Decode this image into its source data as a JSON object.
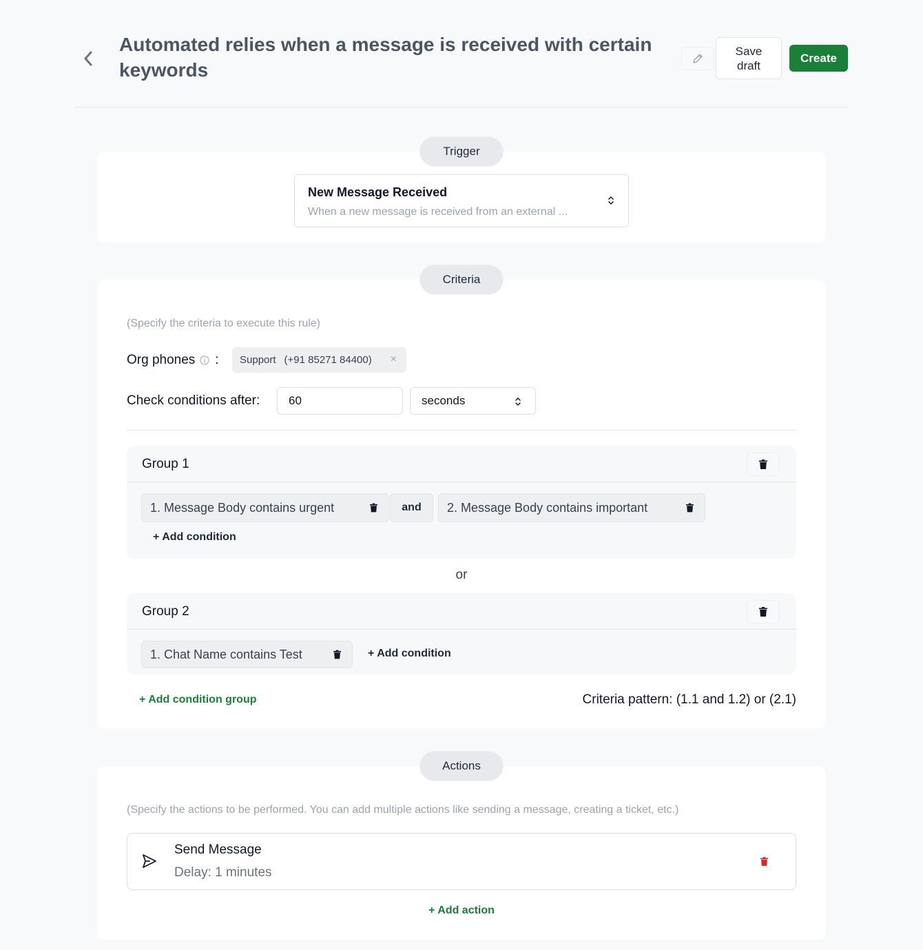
{
  "header": {
    "title": "Automated relies when a message is received with certain keywords",
    "save_draft_label": "Save draft",
    "create_label": "Create"
  },
  "trigger": {
    "section_label": "Trigger",
    "selected_title": "New Message Received",
    "selected_description": "When a new message is received from an external ..."
  },
  "criteria": {
    "section_label": "Criteria",
    "hint": "(Specify the criteria to execute this rule)",
    "org_phones_label": "Org phones",
    "org_phone_tag": {
      "name": "Support",
      "number": "(+91 85271 84400)"
    },
    "check_after_label": "Check conditions after:",
    "check_after_value": "60",
    "check_after_unit": "seconds",
    "groups": [
      {
        "title": "Group 1",
        "conditions": [
          "1. Message Body contains urgent",
          "2. Message Body contains important"
        ],
        "joiner": "and",
        "add_condition_label": "+ Add condition"
      },
      {
        "title": "Group 2",
        "conditions": [
          "1. Chat Name contains Test"
        ],
        "add_condition_label": "+ Add condition"
      }
    ],
    "group_joiner": "or",
    "add_group_label": "+ Add condition group",
    "pattern_text": "Criteria pattern: (1.1 and 1.2) or (2.1)"
  },
  "actions": {
    "section_label": "Actions",
    "hint": "(Specify the actions to be performed. You can add multiple actions like sending a message, creating a ticket, etc.)",
    "items": [
      {
        "title": "Send Message",
        "subtitle": "Delay: 1 minutes",
        "icon": "send-icon"
      }
    ],
    "add_action_label": "+ Add action"
  },
  "colors": {
    "accent_green": "#1a7f37",
    "danger_red": "#dc2626",
    "page_bg": "#f8f9fb"
  }
}
